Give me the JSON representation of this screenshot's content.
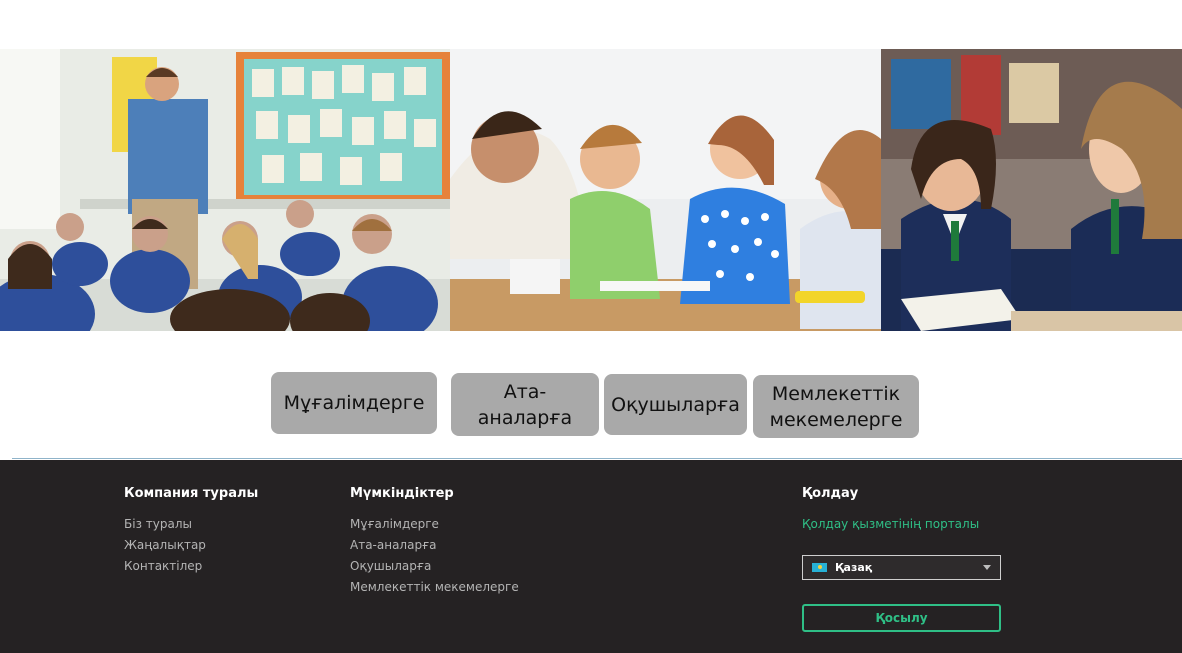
{
  "audience": {
    "buttons": [
      {
        "label": "Мұғалімдерге"
      },
      {
        "label": "Ата-аналарға"
      },
      {
        "label": "Оқушыларға"
      },
      {
        "label": "Мемлекеттік мекемелерге"
      }
    ]
  },
  "footer": {
    "about": {
      "title": "Компания туралы",
      "links": [
        "Біз туралы",
        "Жаңалықтар",
        "Контактілер"
      ]
    },
    "features": {
      "title": "Мүмкіндіктер",
      "links": [
        "Мұғалімдерге",
        "Ата-аналарға",
        "Оқушыларға",
        "Мемлекеттік мекемелерге"
      ]
    },
    "support": {
      "title": "Қолдау",
      "portal_link": "Қолдау қызметінің порталы",
      "language": "Қазақ",
      "join_label": "Қосылу"
    }
  },
  "colors": {
    "footer_bg": "#252223",
    "accent_green": "#2fbf86",
    "button_gray": "#a9a9a9"
  }
}
